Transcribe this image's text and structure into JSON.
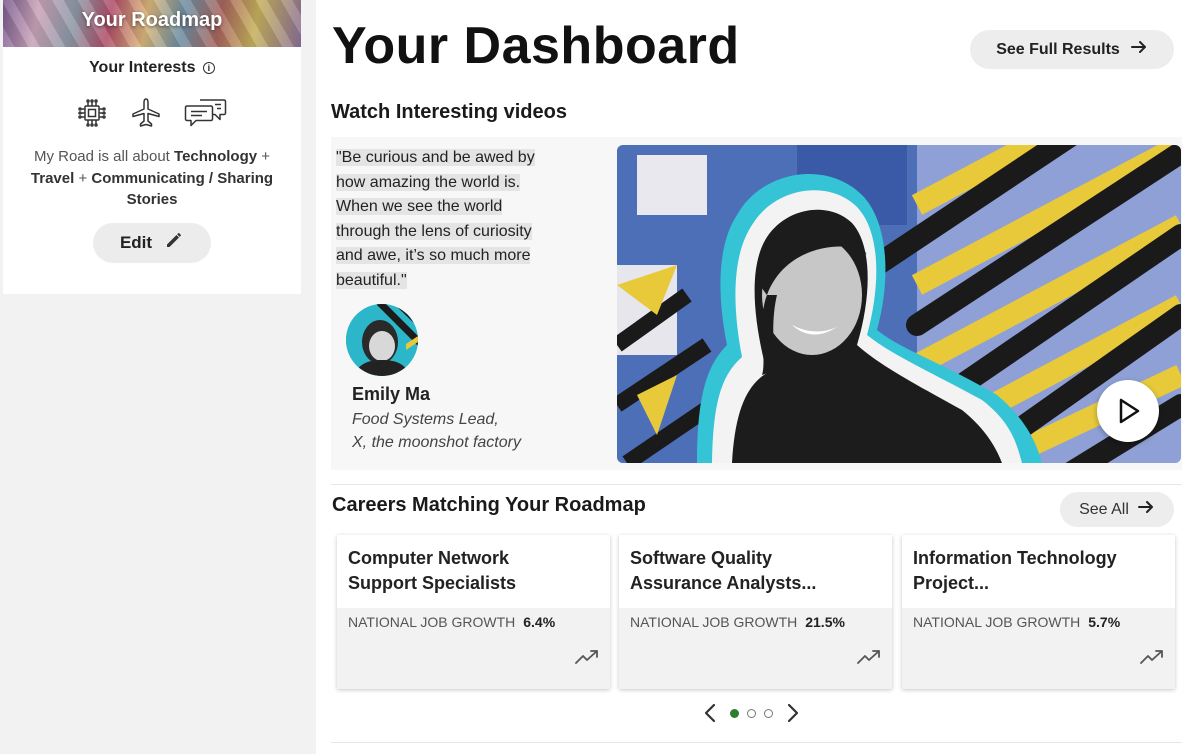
{
  "sidebar": {
    "banner_title": "Your Roadmap",
    "interests_label": "Your Interests",
    "interest_icons": [
      "chip-icon",
      "airplane-icon",
      "chat-bubbles-icon"
    ],
    "road_prefix": "My Road is all about ",
    "road_interest_1": "Technology",
    "road_plus_1": " + ",
    "road_interest_2": "Travel",
    "road_plus_2": " + ",
    "road_interest_3": "Communicating / Sharing Stories",
    "edit_label": "Edit"
  },
  "header": {
    "title": "Your Dashboard",
    "full_results_label": "See Full Results"
  },
  "videos": {
    "heading": "Watch Interesting videos",
    "quote_lines": [
      "\"Be curious and be awed by",
      "how amazing the world is.",
      "When we see the world",
      "through the lens of curiosity",
      "and awe, it’s so much more",
      "beautiful.\""
    ],
    "speaker_name": "Emily Ma",
    "speaker_role_1": "Food Systems Lead,",
    "speaker_role_2": "X, the moonshot factory"
  },
  "careers": {
    "heading": "Careers Matching Your Roadmap",
    "see_all_label": "See All",
    "growth_label": "NATIONAL JOB GROWTH",
    "cards": [
      {
        "title_1": "Computer Network",
        "title_2": "Support Specialists",
        "growth": "6.4%"
      },
      {
        "title_1": "Software Quality",
        "title_2": "Assurance Analysts...",
        "growth": "21.5%"
      },
      {
        "title_1": "Information Technology",
        "title_2": "Project...",
        "growth": "5.7%"
      }
    ],
    "carousel_page": 1,
    "carousel_pages": 3
  },
  "colors": {
    "accent_dot": "#2e7d32",
    "thumbnail_cyan": "#35c3d6",
    "thumbnail_yellow": "#e7c93a"
  }
}
